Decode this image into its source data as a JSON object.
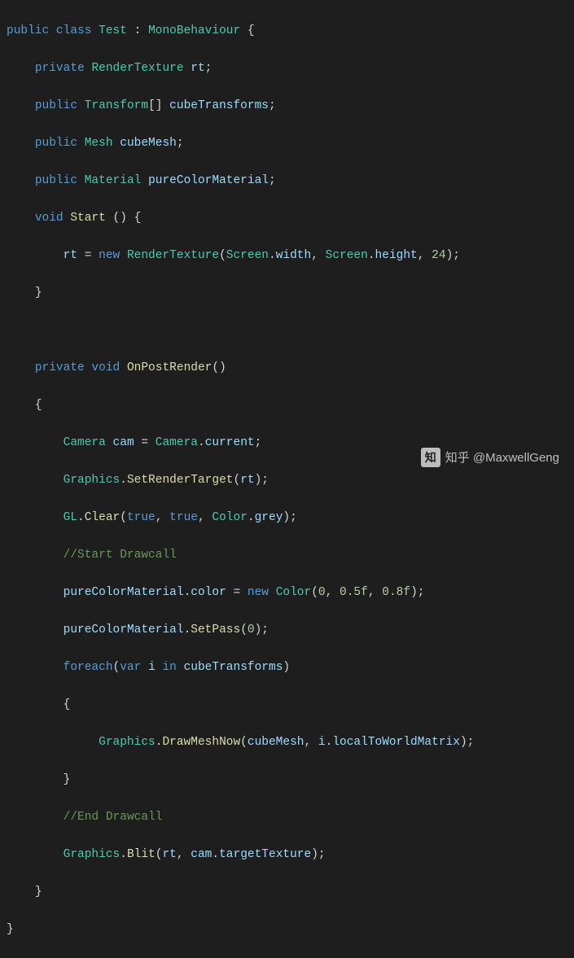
{
  "code": {
    "l1": {
      "kw_public": "public",
      "kw_class": "class",
      "cls": "Test",
      "colon": " : ",
      "base": "MonoBehaviour",
      "tail": " {"
    },
    "l2": {
      "indent": "    ",
      "kw": "private",
      "sp": " ",
      "type": "RenderTexture",
      "sp2": " ",
      "name": "rt",
      "semi": ";"
    },
    "l3": {
      "indent": "    ",
      "kw": "public",
      "sp": " ",
      "type": "Transform",
      "arr": "[] ",
      "name": "cubeTransforms",
      "semi": ";"
    },
    "l4": {
      "indent": "    ",
      "kw": "public",
      "sp": " ",
      "type": "Mesh",
      "sp2": " ",
      "name": "cubeMesh",
      "semi": ";"
    },
    "l5": {
      "indent": "    ",
      "kw": "public",
      "sp": " ",
      "type": "Material",
      "sp2": " ",
      "name": "pureColorMaterial",
      "semi": ";"
    },
    "l6": {
      "indent": "    ",
      "kw_void": "void",
      "sp": " ",
      "method": "Start",
      "tail": " () {"
    },
    "l7": {
      "indent": "        ",
      "lhs": "rt",
      "eq": " = ",
      "kw_new": "new",
      "sp": " ",
      "ctor": "RenderTexture",
      "op": "(",
      "a1t": "Screen",
      "a1d": ".",
      "a1p": "width",
      "c1": ", ",
      "a2t": "Screen",
      "a2d": ".",
      "a2p": "height",
      "c2": ", ",
      "num": "24",
      "cp": ");"
    },
    "l8": {
      "indent": "    ",
      "brace": "}"
    },
    "l9": {
      "blank": ""
    },
    "l10": {
      "indent": "    ",
      "kw_priv": "private",
      "sp": " ",
      "kw_void": "void",
      "sp2": " ",
      "method": "OnPostRender",
      "tail": "()"
    },
    "l11": {
      "indent": "    ",
      "brace": "{"
    },
    "l12": {
      "indent": "        ",
      "type": "Camera",
      "sp": " ",
      "var": "cam",
      "eq": " = ",
      "type2": "Camera",
      "dot": ".",
      "prop": "current",
      "semi": ";"
    },
    "l13": {
      "indent": "        ",
      "cls": "Graphics",
      "dot": ".",
      "method": "SetRenderTarget",
      "op": "(",
      "arg": "rt",
      "cp": ");"
    },
    "l14": {
      "indent": "        ",
      "cls": "GL",
      "dot": ".",
      "method": "Clear",
      "op": "(",
      "a1": "true",
      "c1": ", ",
      "a2": "true",
      "c2": ", ",
      "a3t": "Color",
      "a3d": ".",
      "a3p": "grey",
      "cp": ");"
    },
    "l15": {
      "indent": "        ",
      "comment": "//Start Drawcall"
    },
    "l16": {
      "indent": "        ",
      "obj": "pureColorMaterial",
      "dot": ".",
      "prop": "color",
      "eq": " = ",
      "kw_new": "new",
      "sp": " ",
      "ctor": "Color",
      "op": "(",
      "n1": "0",
      "c1": ", ",
      "n2": "0.5f",
      "c2": ", ",
      "n3": "0.8f",
      "cp": ");"
    },
    "l17": {
      "indent": "        ",
      "obj": "pureColorMaterial",
      "dot": ".",
      "method": "SetPass",
      "op": "(",
      "n": "0",
      "cp": ");"
    },
    "l18": {
      "indent": "        ",
      "kw_foreach": "foreach",
      "op": "(",
      "kw_var": "var",
      "sp": " ",
      "iter": "i",
      "sp2": " ",
      "kw_in": "in",
      "sp3": " ",
      "coll": "cubeTransforms",
      "cp": ")"
    },
    "l19": {
      "indent": "        ",
      "brace": "{"
    },
    "l20": {
      "indent": "             ",
      "cls": "Graphics",
      "dot": ".",
      "method": "DrawMeshNow",
      "op": "(",
      "a1": "cubeMesh",
      "c1": ", ",
      "a2": "i",
      "a2d": ".",
      "a2p": "localToWorldMatrix",
      "cp": ");"
    },
    "l21": {
      "indent": "        ",
      "brace": "}"
    },
    "l22": {
      "indent": "        ",
      "comment": "//End Drawcall"
    },
    "l23": {
      "indent": "        ",
      "cls": "Graphics",
      "dot": ".",
      "method": "Blit",
      "op": "(",
      "a1": "rt",
      "c1": ", ",
      "a2": "cam",
      "a2d": ".",
      "a2p": "targetTexture",
      "cp": ");"
    },
    "l24": {
      "indent": "    ",
      "brace": "}"
    },
    "l25": {
      "brace": "}"
    }
  },
  "watermark": {
    "logo": "知",
    "text": "知乎 @MaxwellGeng"
  }
}
